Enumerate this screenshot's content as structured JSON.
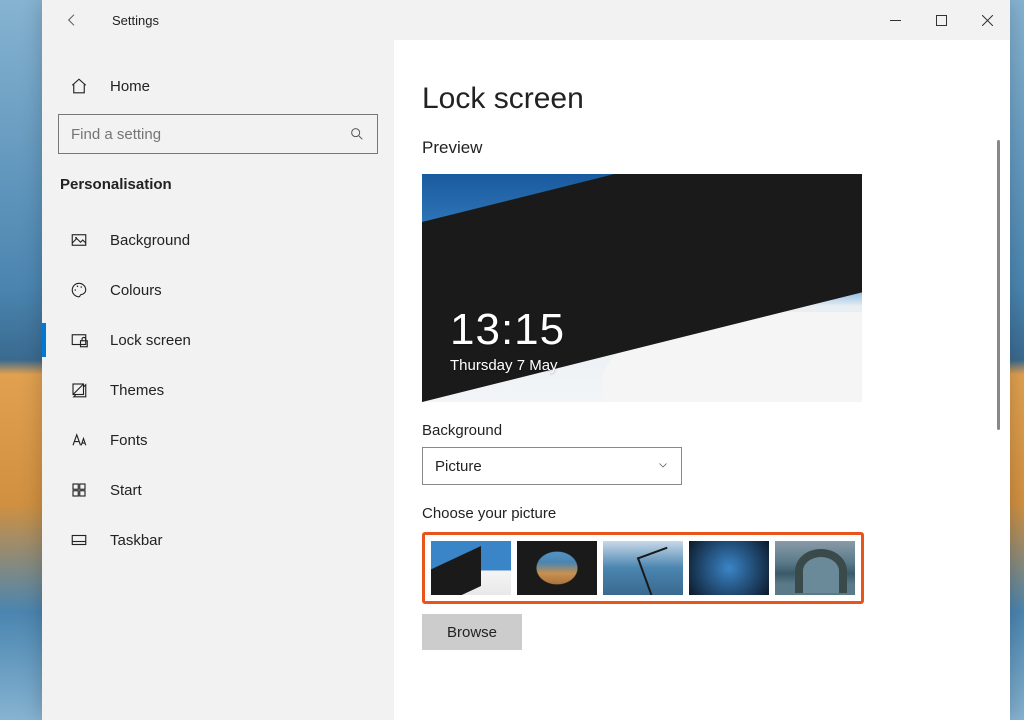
{
  "window": {
    "title": "Settings"
  },
  "sidebar": {
    "home_label": "Home",
    "search_placeholder": "Find a setting",
    "category": "Personalisation",
    "items": [
      {
        "label": "Background"
      },
      {
        "label": "Colours"
      },
      {
        "label": "Lock screen"
      },
      {
        "label": "Themes"
      },
      {
        "label": "Fonts"
      },
      {
        "label": "Start"
      },
      {
        "label": "Taskbar"
      }
    ],
    "selected_index": 2
  },
  "main": {
    "page_title": "Lock screen",
    "preview_label": "Preview",
    "preview_time": "13:15",
    "preview_date": "Thursday 7 May",
    "background_label": "Background",
    "background_value": "Picture",
    "choose_label": "Choose your picture",
    "browse_label": "Browse"
  }
}
